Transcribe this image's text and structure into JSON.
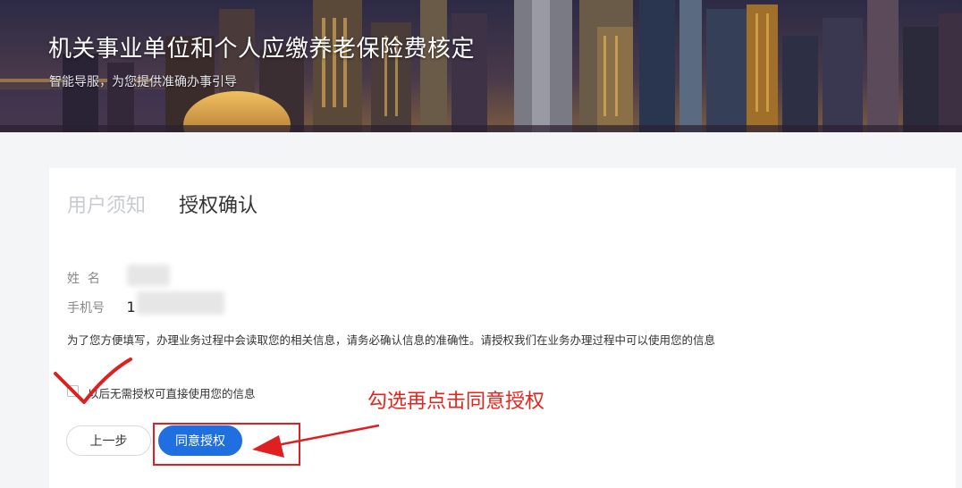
{
  "banner": {
    "title": "机关事业单位和个人应缴养老保险费核定",
    "subtitle": "智能导服，为您提供准确办事引导"
  },
  "tabs": [
    {
      "label": "用户须知",
      "active": false
    },
    {
      "label": "授权确认",
      "active": true
    }
  ],
  "form": {
    "name_label": "姓  名",
    "name_value": "",
    "phone_label": "手机号",
    "phone_prefix": "1",
    "phone_suffix": "",
    "notice": "为了您方便填写，办理业务过程中会读取您的相关信息，请务必确认信息的准确性。请授权我们在业务办理过程中可以使用您的信息",
    "checkbox_label": "以后无需授权可直接使用您的信息",
    "checkbox_checked": false
  },
  "buttons": {
    "prev_label": "上一步",
    "agree_label": "同意授权"
  },
  "annotation": {
    "text": "勾选再点击同意授权",
    "color": "#e8231c"
  },
  "colors": {
    "accent": "#1f6fe0",
    "annotation_red": "#e02020"
  }
}
